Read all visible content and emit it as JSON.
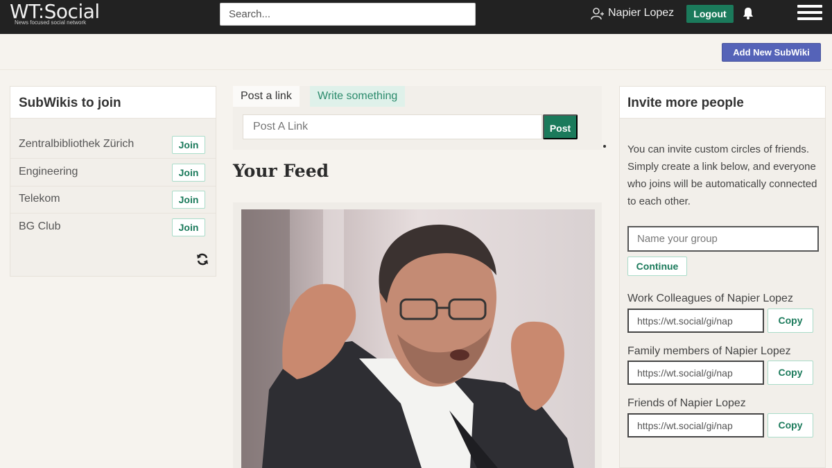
{
  "header": {
    "logo_text": "WT:Social",
    "logo_tagline": "News focused social network",
    "search_placeholder": "Search...",
    "user_name": "Napier Lopez",
    "logout_label": "Logout",
    "icons": [
      "user-icon",
      "bell-icon",
      "menu-icon"
    ]
  },
  "toolbar": {
    "add_subwiki_label": "Add New SubWiki"
  },
  "subwikis": {
    "title": "SubWikis to join",
    "items": [
      {
        "name": "Zentralbibliothek Zürich",
        "action": "Join"
      },
      {
        "name": "Engineering",
        "action": "Join"
      },
      {
        "name": "Telekom",
        "action": "Join"
      },
      {
        "name": "BG Club",
        "action": "Join"
      }
    ],
    "refresh_icon": "refresh-icon"
  },
  "composer": {
    "tabs": [
      {
        "label": "Post a link",
        "active": false
      },
      {
        "label": "Write something",
        "active": true
      }
    ],
    "link_placeholder": "Post A Link",
    "post_label": "Post"
  },
  "feed": {
    "title": "Your Feed"
  },
  "invite": {
    "title": "Invite more people",
    "description": "You can invite custom circles of friends. Simply create a link below, and everyone who joins will be automatically connected to each other.",
    "group_placeholder": "Name your group",
    "continue_label": "Continue",
    "circles": [
      {
        "label": "Work Colleagues of Napier Lopez",
        "url": "https://wt.social/gi/nap",
        "copy_label": "Copy"
      },
      {
        "label": "Family members of Napier Lopez",
        "url": "https://wt.social/gi/nap",
        "copy_label": "Copy"
      },
      {
        "label": "Friends of Napier Lopez",
        "url": "https://wt.social/gi/nap",
        "copy_label": "Copy"
      }
    ]
  },
  "colors": {
    "navbar": "#222222",
    "primary_green": "#1b7a5b",
    "subwiki_button": "#5563b8",
    "page_bg": "#f6f3ee"
  }
}
